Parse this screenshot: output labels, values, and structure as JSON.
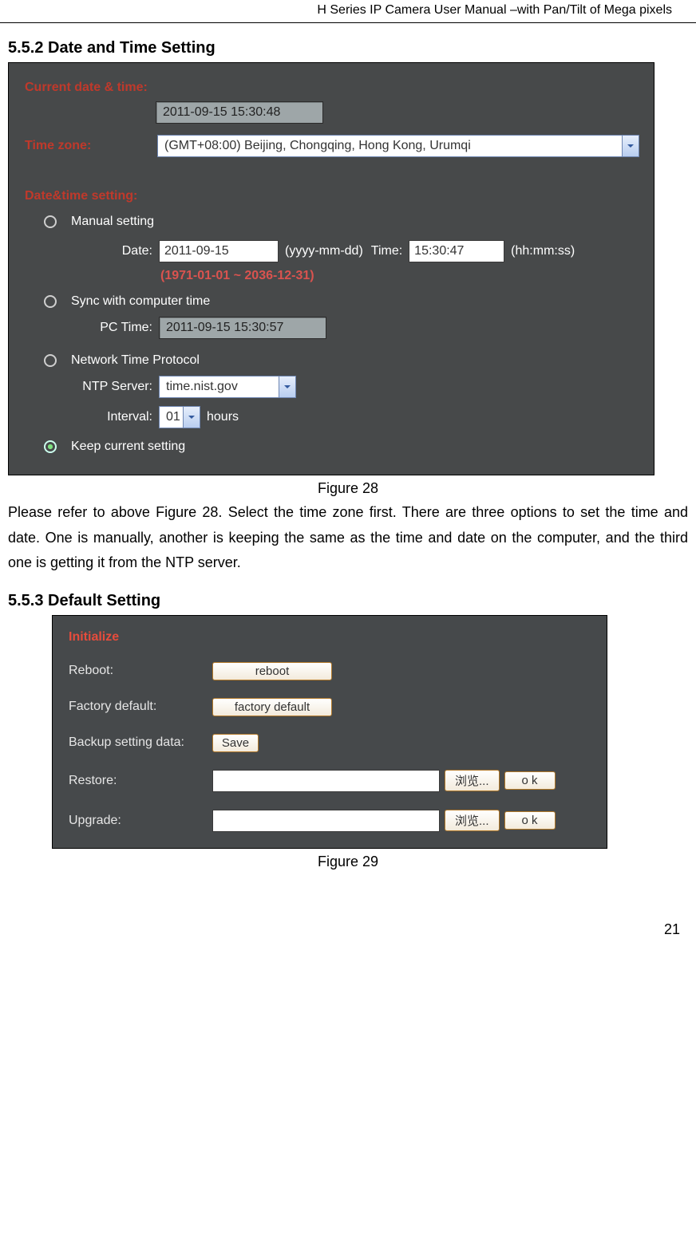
{
  "header": "H Series IP Camera User Manual –with Pan/Tilt of Mega pixels",
  "section_552_title": "5.5.2  Date and Time Setting",
  "figure28": {
    "current_label": "Current date & time:",
    "current_value": "2011-09-15 15:30:48",
    "timezone_label": "Time zone:",
    "timezone_value": "(GMT+08:00) Beijing, Chongqing, Hong Kong, Urumqi",
    "datetime_label": "Date&time setting:",
    "manual": "Manual setting",
    "date_label": "Date:",
    "date_value": "2011-09-15",
    "date_fmt": "(yyyy-mm-dd)",
    "time_label": "Time:",
    "time_value": "15:30:47",
    "time_fmt": "(hh:mm:ss)",
    "range_hint": "(1971-01-01 ~ 2036-12-31)",
    "sync": "Sync with computer time",
    "pctime_label": "PC Time:",
    "pctime_value": "2011-09-15 15:30:57",
    "ntp": "Network Time Protocol",
    "ntp_server_label": "NTP Server:",
    "ntp_server_value": "time.nist.gov",
    "interval_label": "Interval:",
    "interval_value": "01",
    "interval_unit": "hours",
    "keep": "Keep current setting"
  },
  "caption28": "Figure 28",
  "paragraph": "Please refer to above Figure 28. Select the time zone first. There are three options to set the time and date. One is manually, another is keeping the same as the time and date on the computer, and the third one is getting it from the NTP server.",
  "section_553_title": "5.5.3  Default Setting",
  "figure29": {
    "initialize": "Initialize",
    "reboot_label": "Reboot:",
    "reboot_btn": "reboot",
    "factory_label": "Factory default:",
    "factory_btn": "factory default",
    "backup_label": "Backup setting data:",
    "backup_btn": "Save",
    "restore_label": "Restore:",
    "browse": "浏览...",
    "ok": "o k",
    "upgrade_label": "Upgrade:"
  },
  "caption29": "Figure 29",
  "page_number": "21"
}
